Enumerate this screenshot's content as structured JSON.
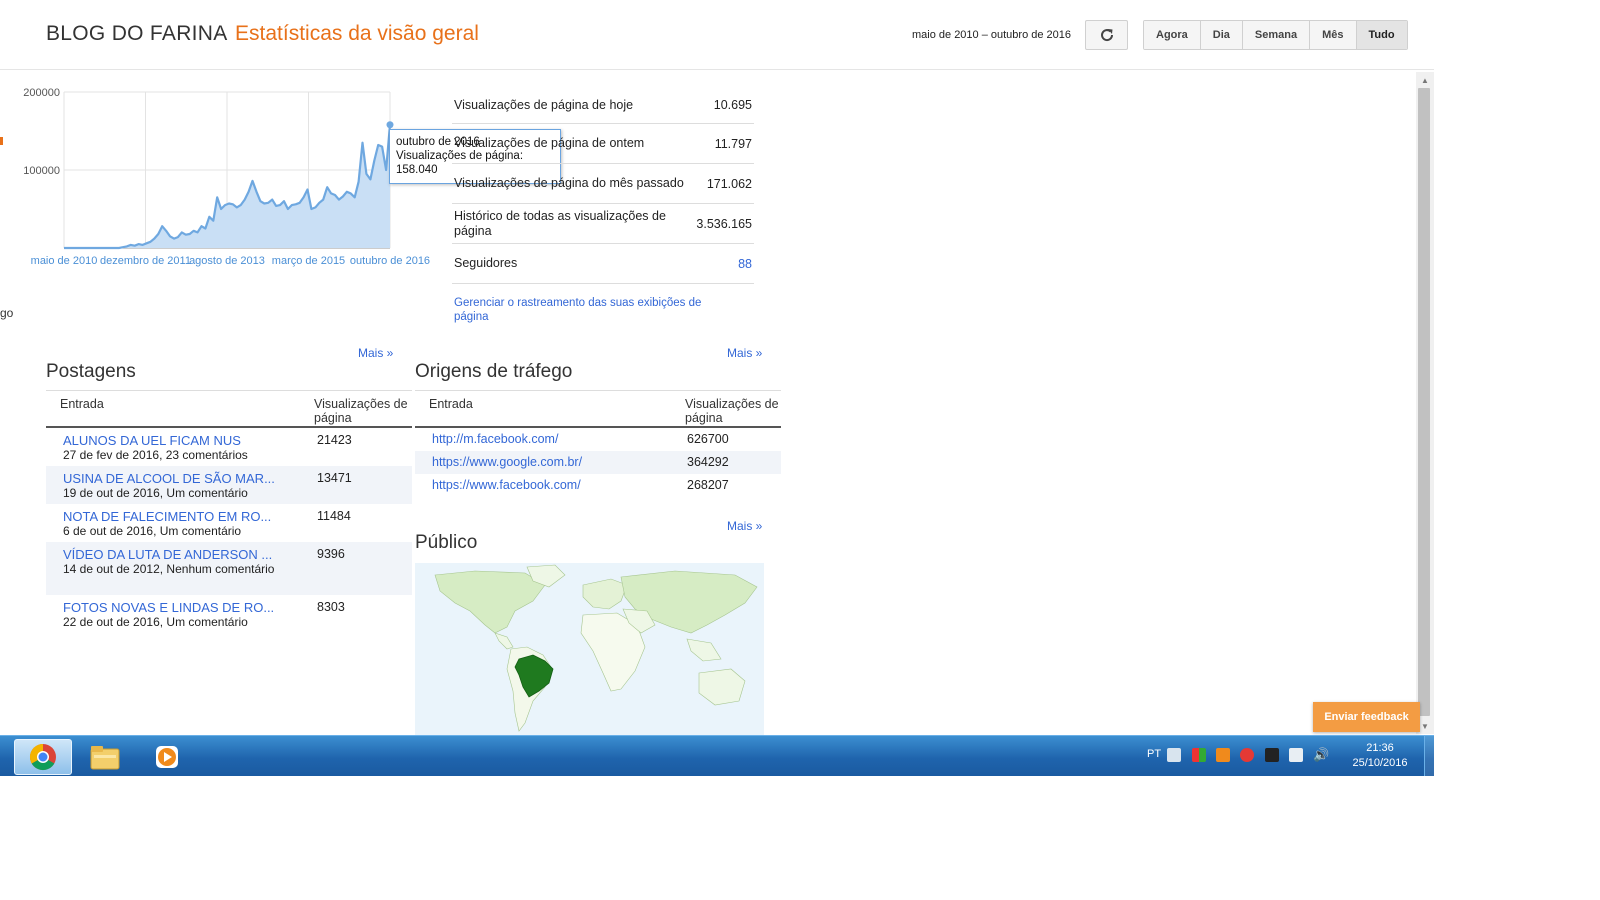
{
  "header": {
    "blog_title": "BLOG DO FARINA",
    "separator": "·",
    "page_heading": "Estatísticas da visão geral",
    "date_range": "maio de 2010 – outubro de 2016",
    "refresh_icon": "refresh-icon",
    "range_buttons": [
      "Agora",
      "Dia",
      "Semana",
      "Mês",
      "Tudo"
    ],
    "active_range": "Tudo"
  },
  "chart_data": {
    "type": "area",
    "title": "",
    "xlabel": "",
    "ylabel": "",
    "x_tick_labels": [
      "maio de 2010",
      "dezembro de 2011",
      "agosto de 2013",
      "março de 2015",
      "outubro de 2016"
    ],
    "y_tick_labels": [
      "200000",
      "100000"
    ],
    "ylim": [
      0,
      200000
    ],
    "grid": true,
    "series": [
      {
        "name": "Visualizações de página",
        "color": "#6fa8e0",
        "values": [
          0,
          0,
          0,
          0,
          0,
          0,
          0,
          0,
          0,
          0,
          0,
          0,
          0,
          0,
          0,
          1000,
          2000,
          4000,
          3000,
          5000,
          4000,
          6000,
          8000,
          12000,
          18000,
          28000,
          22000,
          15000,
          12000,
          14000,
          20000,
          17000,
          18000,
          22000,
          20000,
          28000,
          25000,
          40000,
          35000,
          65000,
          50000,
          55000,
          57000,
          56000,
          52000,
          55000,
          62000,
          72000,
          86000,
          72000,
          60000,
          57000,
          58000,
          62000,
          54000,
          55000,
          60000,
          50000,
          55000,
          56000,
          58000,
          65000,
          75000,
          50000,
          52000,
          58000,
          62000,
          78000,
          70000,
          68000,
          62000,
          66000,
          72000,
          70000,
          65000,
          85000,
          135000,
          95000,
          88000,
          112000,
          132000,
          130000,
          100000,
          158040
        ]
      }
    ],
    "tooltip": {
      "date": "outubro de 2016",
      "label": "Visualizações de página:",
      "value": "158.040"
    }
  },
  "stats": {
    "rows": [
      {
        "label": "Visualizações de página de hoje",
        "value": "10.695"
      },
      {
        "label": "Visualizações de página de ontem",
        "value": "11.797"
      },
      {
        "label": "Visualizações de página do mês passado",
        "value": "171.062"
      },
      {
        "label": "Histórico de todas as visualizações de página",
        "value": "3.536.165"
      },
      {
        "label": "Seguidores",
        "value": "88"
      }
    ],
    "manage_link": "Gerenciar o rastreamento das suas exibições de página"
  },
  "posts": {
    "title": "Postagens",
    "more": "Mais »",
    "col_entry": "Entrada",
    "col_views": "Visualizações de página",
    "rows": [
      {
        "title": "ALUNOS DA UEL FICAM NUS",
        "meta": "27 de fev de 2016, 23 comentários",
        "views": "21423"
      },
      {
        "title": "USINA DE ALCOOL DE SÃO MAR...",
        "meta": "19 de out de 2016, Um comentário",
        "views": "13471"
      },
      {
        "title": "NOTA DE FALECIMENTO EM RO...",
        "meta": "6 de out de 2016, Um comentário",
        "views": "11484"
      },
      {
        "title": "VÍDEO DA LUTA DE ANDERSON ...",
        "meta": "14 de out de 2012, Nenhum comentário",
        "views": "9396"
      },
      {
        "title": "FOTOS NOVAS E LINDAS DE RO...",
        "meta": "22 de out de 2016, Um comentário",
        "views": "8303"
      }
    ]
  },
  "traffic": {
    "title": "Origens de tráfego",
    "more": "Mais »",
    "col_entry": "Entrada",
    "col_views": "Visualizações de página",
    "rows": [
      {
        "title": "http://m.facebook.com/",
        "views": "626700"
      },
      {
        "title": "https://www.google.com.br/",
        "views": "364292"
      },
      {
        "title": "https://www.facebook.com/",
        "views": "268207"
      }
    ]
  },
  "audience": {
    "title": "Público",
    "more": "Mais »",
    "highlight_color": "#1f7a1f"
  },
  "left_cut_text": "go",
  "feedback_button": "Enviar feedback",
  "taskbar": {
    "apps": [
      "chrome-icon",
      "file-explorer-icon",
      "media-player-icon"
    ],
    "language": "PT",
    "time": "21:36",
    "date": "25/10/2016"
  }
}
